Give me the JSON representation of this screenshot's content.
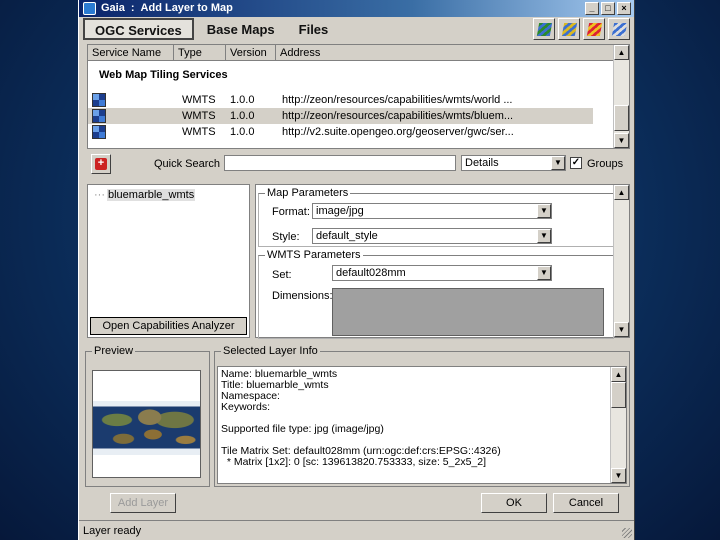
{
  "window": {
    "app_name": "Gaia",
    "title": "Add Layer to Map",
    "buttons": [
      "_",
      "□",
      "×"
    ]
  },
  "tabs": [
    {
      "label": "OGC Services",
      "active": true
    },
    {
      "label": "Base Maps",
      "active": false
    },
    {
      "label": "Files",
      "active": false
    }
  ],
  "toolbar_icons": [
    "green-layers-icon",
    "yellow-layers-icon",
    "red-layers-icon",
    "edit-layers-icon"
  ],
  "services": {
    "columns": [
      "Service Name",
      "Type",
      "Version",
      "Address"
    ],
    "group": "Web Map Tiling Services",
    "rows": [
      {
        "icon": "wmts-service-icon",
        "type": "WMTS",
        "version": "1.0.0",
        "address": "http://zeon/resources/capabilities/wmts/world ...",
        "selected": false
      },
      {
        "icon": "wmts-service-icon",
        "type": "WMTS",
        "version": "1.0.0",
        "address": "http://zeon/resources/capabilities/wmts/bluem...",
        "selected": true
      },
      {
        "icon": "wmts-service-icon",
        "type": "WMTS",
        "version": "1.0.0",
        "address": "http://v2.suite.opengeo.org/geoserver/gwc/ser...",
        "selected": false
      }
    ]
  },
  "quick_search": {
    "label": "Quick Search",
    "value": "",
    "mode": "Details",
    "groups_label": "Groups",
    "groups_checked": true
  },
  "tree": {
    "item": "bluemarble_wmts",
    "button": "Open Capabilities Analyzer"
  },
  "map_params": {
    "legend": "Map Parameters",
    "format_label": "Format:",
    "format_value": "image/jpg",
    "style_label": "Style:",
    "style_value": "default_style"
  },
  "wmts_params": {
    "legend": "WMTS Parameters",
    "set_label": "Set:",
    "set_value": "default028mm",
    "dimensions_label": "Dimensions:"
  },
  "preview": {
    "legend": "Preview"
  },
  "layer_info": {
    "legend": "Selected Layer Info",
    "lines": [
      "Name: bluemarble_wmts",
      "Title: bluemarble_wmts",
      "Namespace:",
      "Keywords:",
      "",
      "Supported file type: jpg (image/jpg)",
      "",
      "Tile Matrix Set: default028mm (urn:ogc:def:crs:EPSG::4326)",
      "  * Matrix [1x2]: 0 [sc: 139613820.753333, size: 5_2x5_2]"
    ]
  },
  "buttons": {
    "add_layer": "Add Layer",
    "ok": "OK",
    "cancel": "Cancel"
  },
  "status": "Layer ready"
}
